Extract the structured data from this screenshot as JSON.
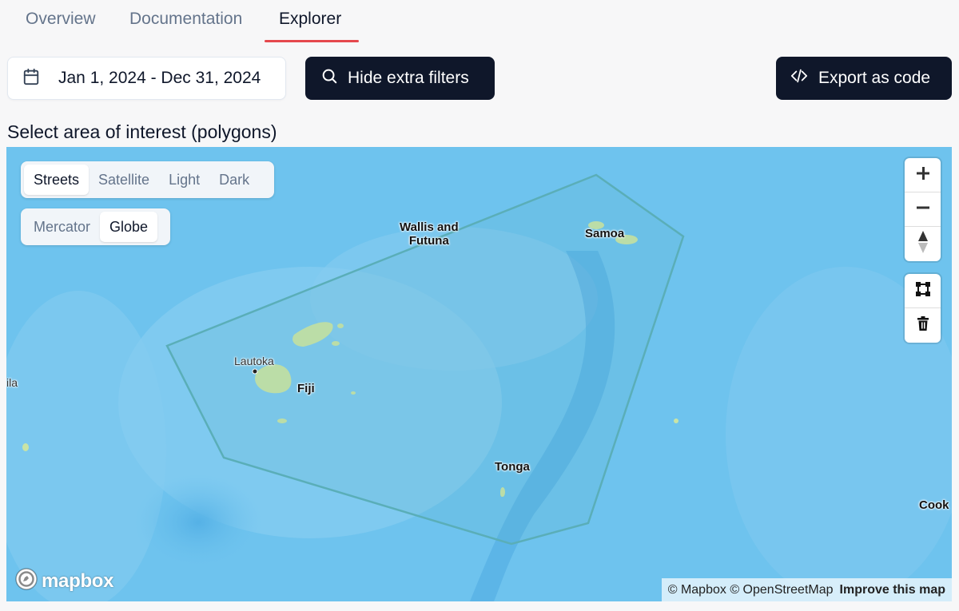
{
  "tabs": [
    {
      "label": "Overview"
    },
    {
      "label": "Documentation"
    },
    {
      "label": "Explorer",
      "active": true
    }
  ],
  "toolbar": {
    "date_range": "Jan 1, 2024 - Dec 31, 2024",
    "filters_label": "Hide extra filters",
    "export_label": "Export as code"
  },
  "section_title": "Select area of interest (polygons)",
  "map": {
    "styles": [
      "Streets",
      "Satellite",
      "Light",
      "Dark"
    ],
    "active_style": "Streets",
    "projections": [
      "Mercator",
      "Globe"
    ],
    "active_projection": "Globe",
    "labels": {
      "wallis": "Wallis and\nFutuna",
      "samoa": "Samoa",
      "fiji": "Fiji",
      "lautoka": "Lautoka",
      "tonga": "Tonga",
      "cook": "Cook",
      "ila": "ila"
    },
    "logo_text": "mapbox",
    "attribution": "© Mapbox © OpenStreetMap",
    "improve": "Improve this map",
    "colors": {
      "water": "#6ec3ee",
      "land": "#c9e4a6",
      "polygon": "#5aaeb8"
    },
    "controls": [
      "plus-icon",
      "minus-icon",
      "compass-icon",
      "draw-polygon-icon",
      "trash-icon"
    ]
  }
}
